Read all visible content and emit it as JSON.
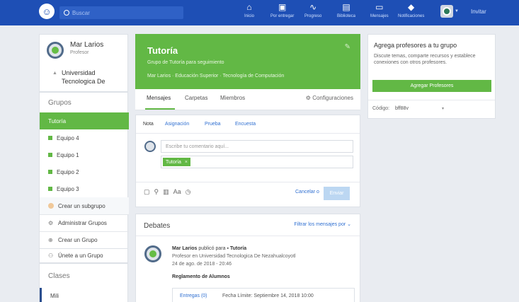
{
  "topbar": {
    "search_placeholder": "Buscar",
    "nav": [
      {
        "label": "Inicio",
        "icon": "home-icon",
        "glyph": "⌂"
      },
      {
        "label": "Por entregar",
        "icon": "inbox-icon",
        "glyph": "▣"
      },
      {
        "label": "Progreso",
        "icon": "progress-icon",
        "glyph": "∿"
      },
      {
        "label": "Biblioteca",
        "icon": "library-icon",
        "glyph": "▤"
      },
      {
        "label": "Mensajes",
        "icon": "messages-icon",
        "glyph": "▭"
      },
      {
        "label": "Notificaciones",
        "icon": "bell-icon",
        "glyph": "◆"
      }
    ],
    "invite": "Invitar"
  },
  "profile": {
    "name": "Mar Larios",
    "role": "Profesor",
    "school": "Universidad Tecnologica De"
  },
  "groups": {
    "title": "Grupos",
    "items": [
      {
        "label": "Tutoría"
      },
      {
        "label": "Equipo 4"
      },
      {
        "label": "Equipo 1"
      },
      {
        "label": "Equipo 2"
      },
      {
        "label": "Equipo 3"
      },
      {
        "label": "Crear un subgrupo"
      },
      {
        "label": "Administrar Grupos"
      },
      {
        "label": "Crear un Grupo"
      },
      {
        "label": "Únete a un Grupo"
      }
    ]
  },
  "classes": {
    "title": "Clases",
    "items": [
      {
        "label": "Mili"
      }
    ]
  },
  "banner": {
    "title": "Tutoría",
    "subtitle": "Grupo de Tutoría para seguimiento",
    "details": "Mar Larios · Educación Superior · Tecnología de Computación"
  },
  "tabs": {
    "items": [
      "Mensajes",
      "Carpetas",
      "Miembros"
    ],
    "settings": "Configuraciones"
  },
  "composer": {
    "types": [
      "Nota",
      "Asignación",
      "Prueba",
      "Encuesta"
    ],
    "placeholder": "Escribe tu comentario aquí...",
    "recipient": "Tutoría",
    "tools_text": "Aa",
    "cancel": "Cancelar o",
    "send": "Enviar"
  },
  "debates": {
    "title": "Debates",
    "filter": "Filtrar los mensajes por",
    "post": {
      "author": "Mar Larios",
      "action": "publicó para",
      "group": "Tutoría",
      "meta": "Profesor en Universidad Tecnologica De Nezahualcoyotl",
      "date": "24 de ago. de 2018 - 20:46",
      "title": "Reglamento de Alumnos",
      "deliveries": "Entregas (0)",
      "deadline": "Fecha Límite: Septiembre 14, 2018 10:00"
    }
  },
  "addprof": {
    "title": "Agrega profesores a tu grupo",
    "desc": "Discute temas, comparte recursos y establece conexiones con otros profesores.",
    "button": "Agregar Profesores",
    "code_label": "Código:",
    "code_value": "bff88v"
  },
  "colors": {
    "brand_blue": "#1e4fb5",
    "accent_green": "#62b845"
  }
}
